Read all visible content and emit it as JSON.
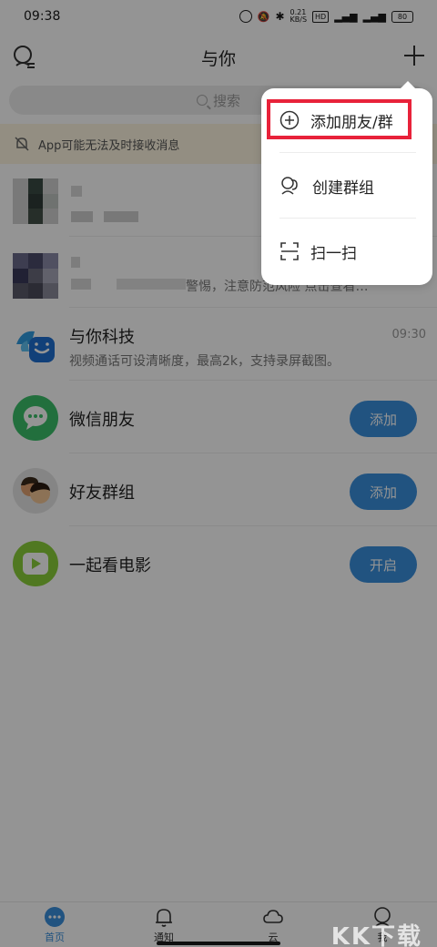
{
  "status_bar": {
    "time": "09:38",
    "network_speed": "0.21\nKB/S",
    "network_label": "HD",
    "battery": "80"
  },
  "header": {
    "title": "与你"
  },
  "search": {
    "placeholder": "搜索"
  },
  "notice": {
    "text": "App可能无法及时接收消息"
  },
  "chats": [
    {
      "title": "与你科技",
      "preview": "视频通话可设清晰度，最高2k，支持录屏截图。",
      "time": "09:30"
    }
  ],
  "chat_partial_preview": "警惕，注意防范风险 点击查看…",
  "features": [
    {
      "label": "微信朋友",
      "button": "添加",
      "color": "#3cc06a"
    },
    {
      "label": "好友群组",
      "button": "添加",
      "color": "#e5e5e5"
    },
    {
      "label": "一起看电影",
      "button": "开启",
      "color": "#8bcf3a"
    }
  ],
  "menu": {
    "items": [
      {
        "label": "添加朋友/群",
        "icon": "add-circle-icon"
      },
      {
        "label": "创建群组",
        "icon": "group-icon"
      },
      {
        "label": "扫一扫",
        "icon": "scan-icon"
      }
    ]
  },
  "tabs": [
    {
      "label": "首页",
      "icon": "chat-bubble-icon",
      "active": true
    },
    {
      "label": "通知",
      "icon": "bell-icon"
    },
    {
      "label": "云",
      "icon": "cloud-icon"
    },
    {
      "label": "我",
      "icon": "person-icon"
    }
  ],
  "watermark": "KK下载",
  "colors": {
    "accent": "#3a8fdd",
    "highlight": "#e8223a",
    "notice_bg": "#fdf5e0"
  }
}
